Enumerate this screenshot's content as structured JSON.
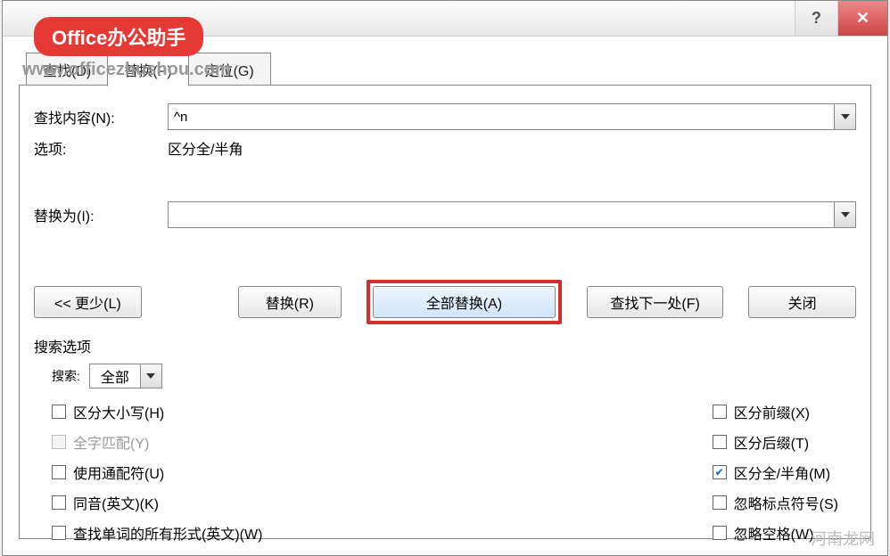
{
  "titlebar": {
    "help_symbol": "?",
    "close_symbol": "✕"
  },
  "watermark": {
    "badge": "Office办公助手",
    "url": "www.officezhushou.com",
    "footer": "河南龙网"
  },
  "tabs": {
    "find": "查找(D)",
    "replace": "替换(P)",
    "goto": "定位(G)"
  },
  "form": {
    "find_label": "查找内容(N):",
    "find_value": "^n",
    "options_label": "选项:",
    "options_value": "区分全/半角",
    "replace_label": "替换为(I):",
    "replace_value": ""
  },
  "buttons": {
    "less": "<< 更少(L)",
    "replace": "替换(R)",
    "replace_all": "全部替换(A)",
    "find_next": "查找下一处(F)",
    "close": "关闭"
  },
  "search_options": {
    "group_label": "搜索选项",
    "search_label": "搜索:",
    "search_value": "全部",
    "left": {
      "match_case": "区分大小写(H)",
      "whole_word": "全字匹配(Y)",
      "wildcards": "使用通配符(U)",
      "sounds_like": "同音(英文)(K)",
      "word_forms": "查找单词的所有形式(英文)(W)"
    },
    "right": {
      "match_prefix": "区分前缀(X)",
      "match_suffix": "区分后缀(T)",
      "match_width": "区分全/半角(M)",
      "ignore_punct": "忽略标点符号(S)",
      "ignore_space": "忽略空格(W)"
    }
  }
}
